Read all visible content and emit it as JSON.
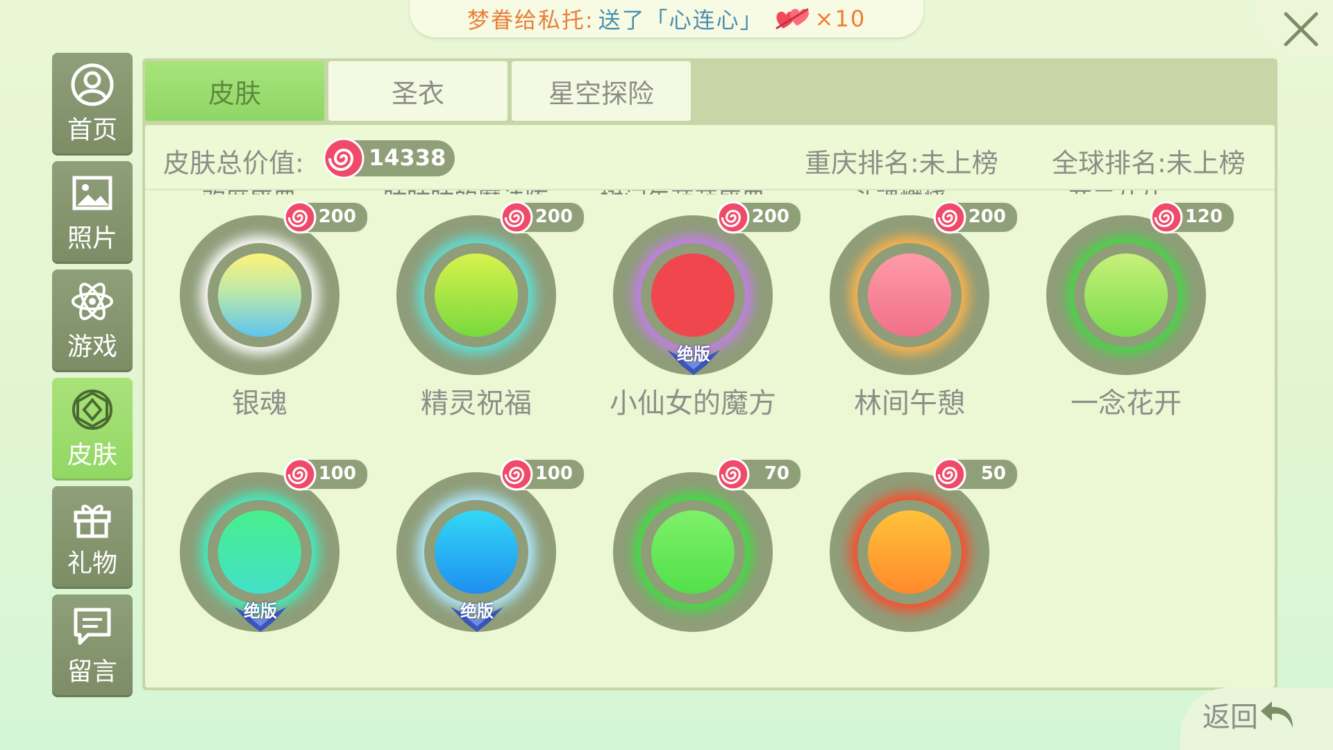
{
  "notice": {
    "sender": "梦眷给私托:",
    "action": "送了「心连心」",
    "count": "×10",
    "gift_icon": "hearts-icon"
  },
  "nav": [
    {
      "label": "首页",
      "icon": "user-icon",
      "active": false
    },
    {
      "label": "照片",
      "icon": "photo-icon",
      "active": false
    },
    {
      "label": "游戏",
      "icon": "atom-icon",
      "active": false
    },
    {
      "label": "皮肤",
      "icon": "gem-icon",
      "active": true
    },
    {
      "label": "礼物",
      "icon": "gift-icon",
      "active": false
    },
    {
      "label": "留言",
      "icon": "message-icon",
      "active": false
    }
  ],
  "tabs": [
    {
      "label": "皮肤",
      "active": true
    },
    {
      "label": "圣衣",
      "active": false
    },
    {
      "label": "星空探险",
      "active": false
    }
  ],
  "info": {
    "total_label": "皮肤总价值:",
    "total_value": "14338",
    "rank_local": "重庆排名:未上榜",
    "rank_global": "全球排名:未上榜"
  },
  "cut_row": [
    "欢度盛典",
    "咕咕咕的魔法阵",
    "树间午萌萌盛典",
    "斗魂燃烧",
    "花元朵朵"
  ],
  "skins": [
    {
      "name": "银魂",
      "price": "200",
      "ball": "linear-gradient(180deg,#fff27a 0%,#bde9a8 45%,#5ec4ef 100%)",
      "ring": "#ffffff",
      "badge": ""
    },
    {
      "name": "精灵祝福",
      "price": "200",
      "ball": "linear-gradient(180deg,#d8f24e,#78d93c)",
      "ring": "#5fe0d8",
      "badge": ""
    },
    {
      "name": "小仙女的魔方",
      "price": "200",
      "ball": "#f0474f",
      "ring": "#c67cf0",
      "badge": "绝版"
    },
    {
      "name": "林间午憩",
      "price": "200",
      "ball": "linear-gradient(180deg,#ff9aa8,#f0708a)",
      "ring": "#ffb24a",
      "badge": ""
    },
    {
      "name": "一念花开",
      "price": "120",
      "ball": "linear-gradient(180deg,#c8f07a,#78dc4c)",
      "ring": "#44d844",
      "badge": ""
    },
    {
      "name": "",
      "price": "100",
      "ball": "linear-gradient(180deg,#48ef8c,#43e0c8)",
      "ring": "#3ef0c0",
      "badge": "绝版"
    },
    {
      "name": "",
      "price": "100",
      "ball": "linear-gradient(180deg,#33d8f5,#1e8ff0)",
      "ring": "#aee8ff",
      "badge": "绝版"
    },
    {
      "name": "",
      "price": "70",
      "ball": "linear-gradient(180deg,#7ef06a,#52e04a)",
      "ring": "#3ee040",
      "badge": ""
    },
    {
      "name": "",
      "price": "50",
      "ball": "linear-gradient(180deg,#ffc23a,#ff8a2c)",
      "ring": "#ff4a2a",
      "badge": ""
    }
  ],
  "back_label": "返回"
}
